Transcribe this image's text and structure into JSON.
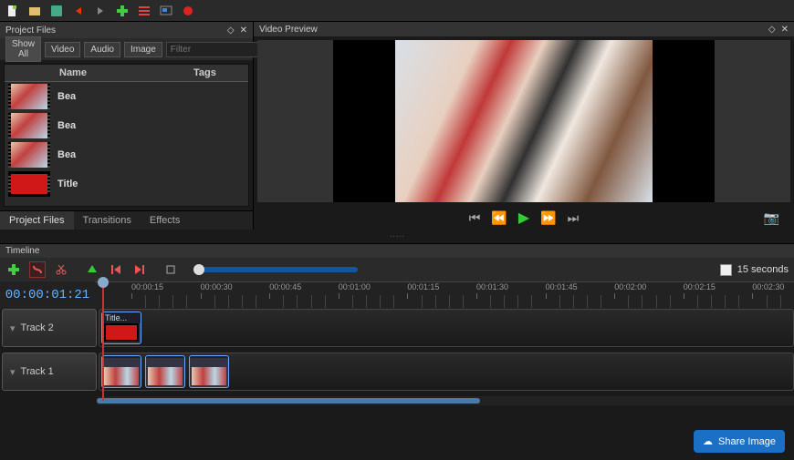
{
  "panels": {
    "project_files": "Project Files",
    "video_preview": "Video Preview"
  },
  "filter": {
    "show_all": "Show All",
    "video": "Video",
    "audio": "Audio",
    "image": "Image",
    "placeholder": "Filter"
  },
  "file_table": {
    "col_name": "Name",
    "col_tags": "Tags",
    "rows": [
      {
        "name": "Bea",
        "type": "video"
      },
      {
        "name": "Bea",
        "type": "video"
      },
      {
        "name": "Bea",
        "type": "video"
      },
      {
        "name": "Title",
        "type": "title"
      }
    ]
  },
  "tabs": {
    "project_files": "Project Files",
    "transitions": "Transitions",
    "effects": "Effects"
  },
  "timeline": {
    "header": "Timeline",
    "duration": "15 seconds",
    "current_time": "00:00:01:21",
    "ticks": [
      "00:00:15",
      "00:00:30",
      "00:00:45",
      "00:01:00",
      "00:01:15",
      "00:01:30",
      "00:01:45",
      "00:02:00",
      "00:02:15",
      "00:02:30"
    ],
    "tracks": {
      "track2": "Track 2",
      "track1": "Track 1"
    },
    "clips": {
      "title": "Title..."
    }
  },
  "share": "Share Image"
}
